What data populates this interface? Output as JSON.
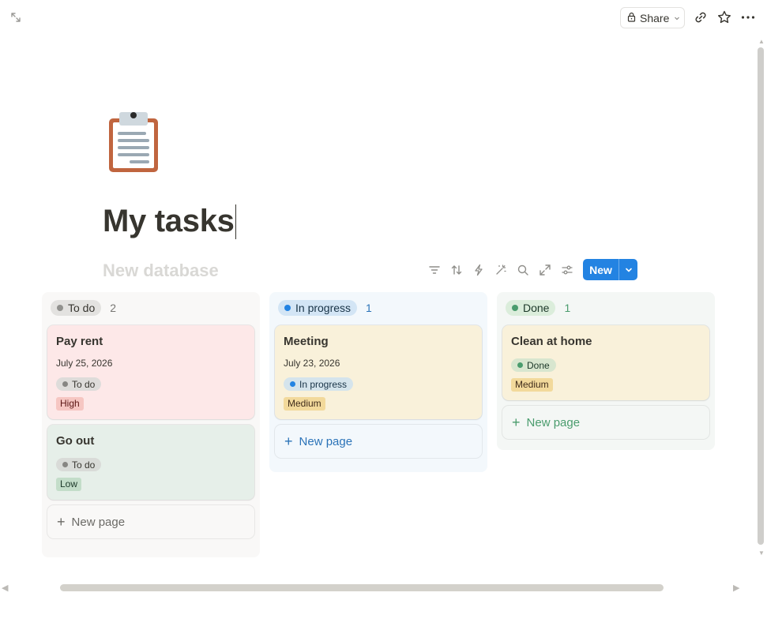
{
  "topbar": {
    "expand_icon": "expand-icon",
    "share_label": "Share",
    "icons": [
      "link-icon",
      "star-icon",
      "more-icon"
    ]
  },
  "page": {
    "icon": "clipboard-icon",
    "title": "My tasks",
    "database_title": "New database"
  },
  "toolbar": {
    "icons": [
      "filter-icon",
      "sort-icon",
      "automation-icon",
      "magic-icon",
      "search-icon",
      "fullscreen-icon",
      "settings-icon"
    ],
    "new_label": "New"
  },
  "colors": {
    "accent": "#2383e2",
    "todo_dot": "#91918e",
    "progress_dot": "#2383e2",
    "done_dot": "#4a9c6d"
  },
  "columns": [
    {
      "id": "todo",
      "label": "To do",
      "count": "2",
      "cards": [
        {
          "title": "Pay rent",
          "date": "July 25, 2026",
          "status": "To do",
          "priority": "High"
        },
        {
          "title": "Go out",
          "date": "",
          "status": "To do",
          "priority": "Low"
        }
      ],
      "new_page_label": "New page"
    },
    {
      "id": "progress",
      "label": "In progress",
      "count": "1",
      "cards": [
        {
          "title": "Meeting",
          "date": "July 23, 2026",
          "status": "In progress",
          "priority": "Medium"
        }
      ],
      "new_page_label": "New page"
    },
    {
      "id": "done",
      "label": "Done",
      "count": "1",
      "cards": [
        {
          "title": "Clean at home",
          "date": "",
          "status": "Done",
          "priority": "Medium"
        }
      ],
      "new_page_label": "New page"
    }
  ]
}
